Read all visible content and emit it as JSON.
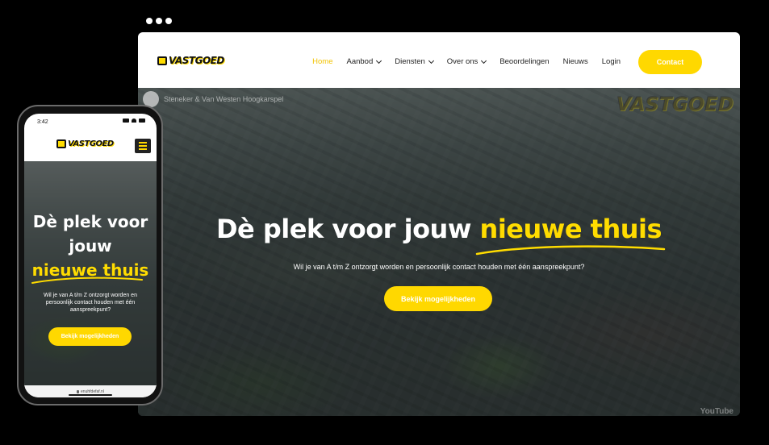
{
  "brand": {
    "logo_text": "VASTGOED",
    "accent": "#ffd800",
    "highlight": "#ffdc00"
  },
  "desktop": {
    "nav": [
      {
        "label": "Home",
        "dropdown": false,
        "active": true
      },
      {
        "label": "Aanbod",
        "dropdown": true,
        "active": false
      },
      {
        "label": "Diensten",
        "dropdown": true,
        "active": false
      },
      {
        "label": "Over ons",
        "dropdown": true,
        "active": false
      },
      {
        "label": "Beoordelingen",
        "dropdown": false,
        "active": false
      },
      {
        "label": "Nieuws",
        "dropdown": false,
        "active": false
      },
      {
        "label": "Login",
        "dropdown": false,
        "active": false
      }
    ],
    "contact_label": "Contact",
    "video": {
      "channel_title": "Steneker & Van Westen Hoogkarspel",
      "watermark": "VASTGOED",
      "platform": "YouTube"
    },
    "hero": {
      "title_start": "Dè plek voor jouw ",
      "title_highlight": "nieuwe thuis",
      "subtitle": "Wil je van A t/m Z ontzorgt worden en persoonlijk contact houden met één aanspreekpunt?",
      "cta_label": "Bekijk mogelijkheden"
    }
  },
  "mobile": {
    "time": "3:42",
    "logo_text": "VASTGOED",
    "hero": {
      "title_line1": "Dè plek voor",
      "title_line2": "jouw",
      "title_highlight": "nieuwe thuis",
      "subtitle": "Wil je van A t/m Z ontzorgt worden en persoonlijk contact houden met één aanspreekpunt?",
      "cta_label": "Bekijk mogelijkheden"
    },
    "url": "enuhfdefaf.nl"
  }
}
